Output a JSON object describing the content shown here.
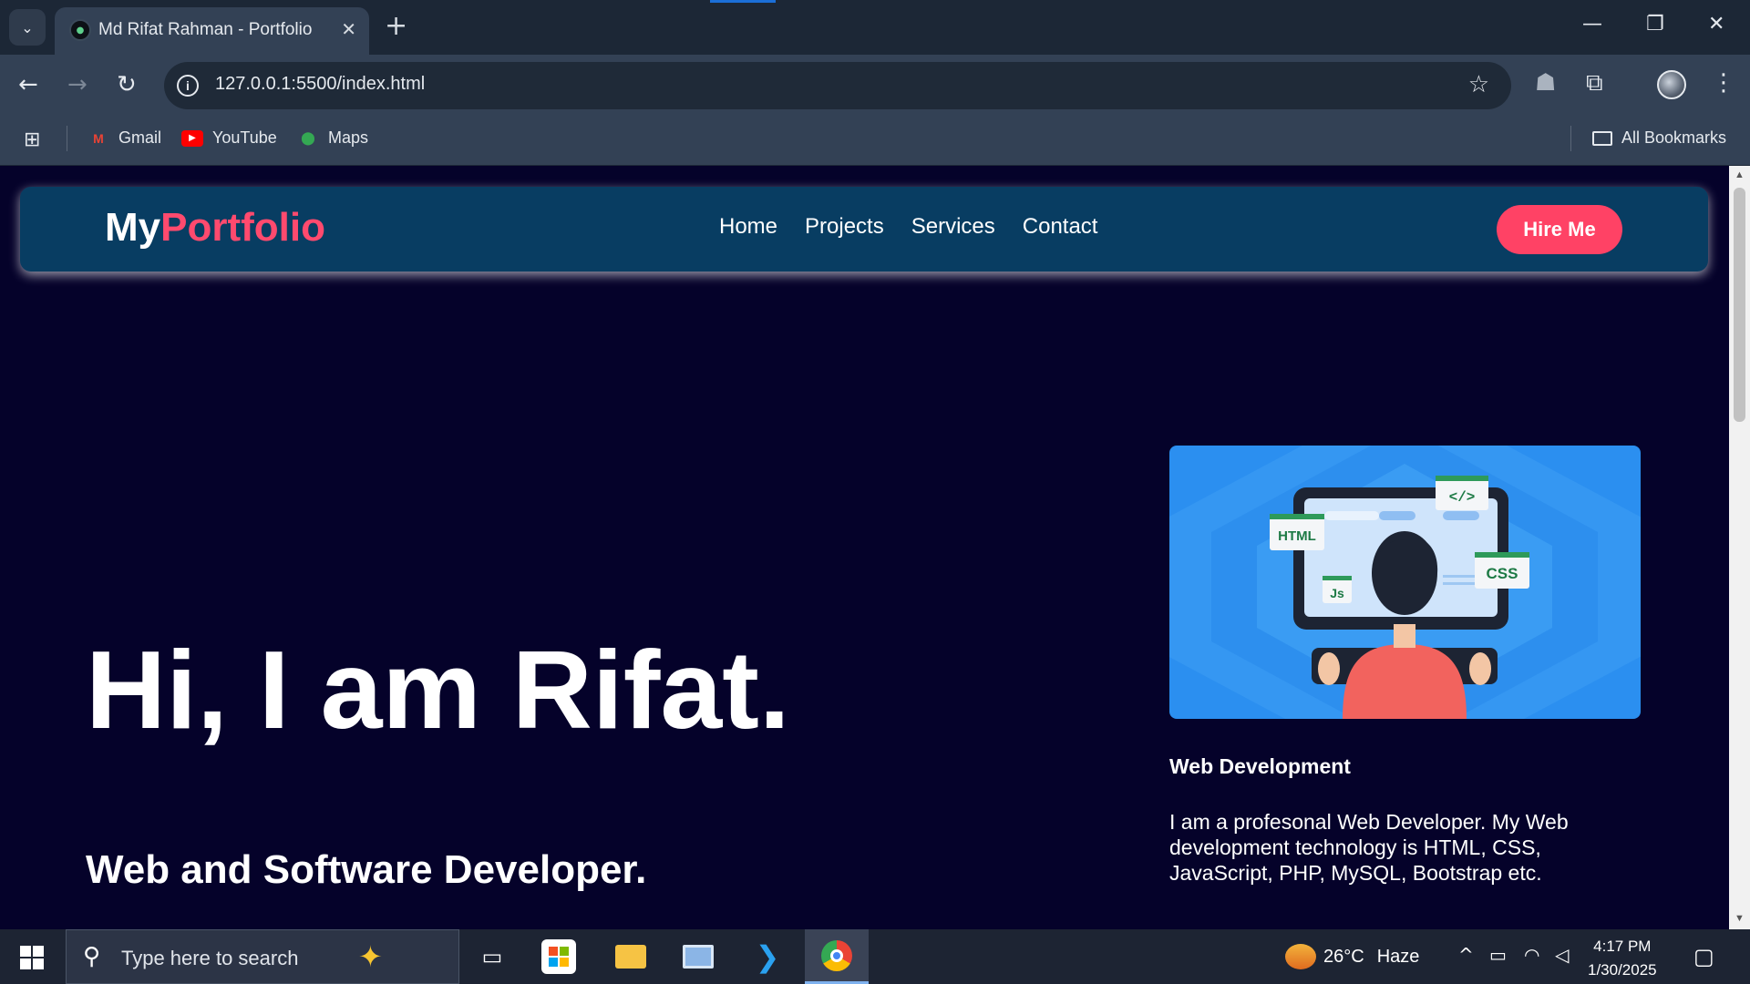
{
  "browser": {
    "tab_title": "Md Rifat Rahman - Portfolio",
    "url": "127.0.0.1:5500/index.html",
    "bookmarks": [
      {
        "label": "Gmail",
        "icon": "gmail-icon"
      },
      {
        "label": "YouTube",
        "icon": "youtube-icon"
      },
      {
        "label": "Maps",
        "icon": "maps-icon"
      }
    ],
    "all_bookmarks_label": "All Bookmarks"
  },
  "page": {
    "logo": {
      "part1": "My",
      "part2": "Portfolio"
    },
    "nav": [
      "Home",
      "Projects",
      "Services",
      "Contact"
    ],
    "hire_button": "Hire Me",
    "hero_title": "Hi, I am Rifat.",
    "hero_subtitle": "Web and Software Developer.",
    "service": {
      "title": "Web Development",
      "description": "I am a profesonal Web Developer. My Web development technology is HTML, CSS, JavaScript, PHP, MySQL, Bootstrap etc.",
      "illustration_tags": [
        "HTML",
        "</>",
        "CSS",
        "Js"
      ]
    },
    "colors": {
      "background": "#05022a",
      "navbar": "#083d62",
      "accent": "#ff4a6e",
      "illustration_bg": "#2b8ff0"
    }
  },
  "taskbar": {
    "search_placeholder": "Type here to search",
    "weather_temp": "26°C",
    "weather_condition": "Haze",
    "time": "4:17 PM",
    "date": "1/30/2025"
  }
}
